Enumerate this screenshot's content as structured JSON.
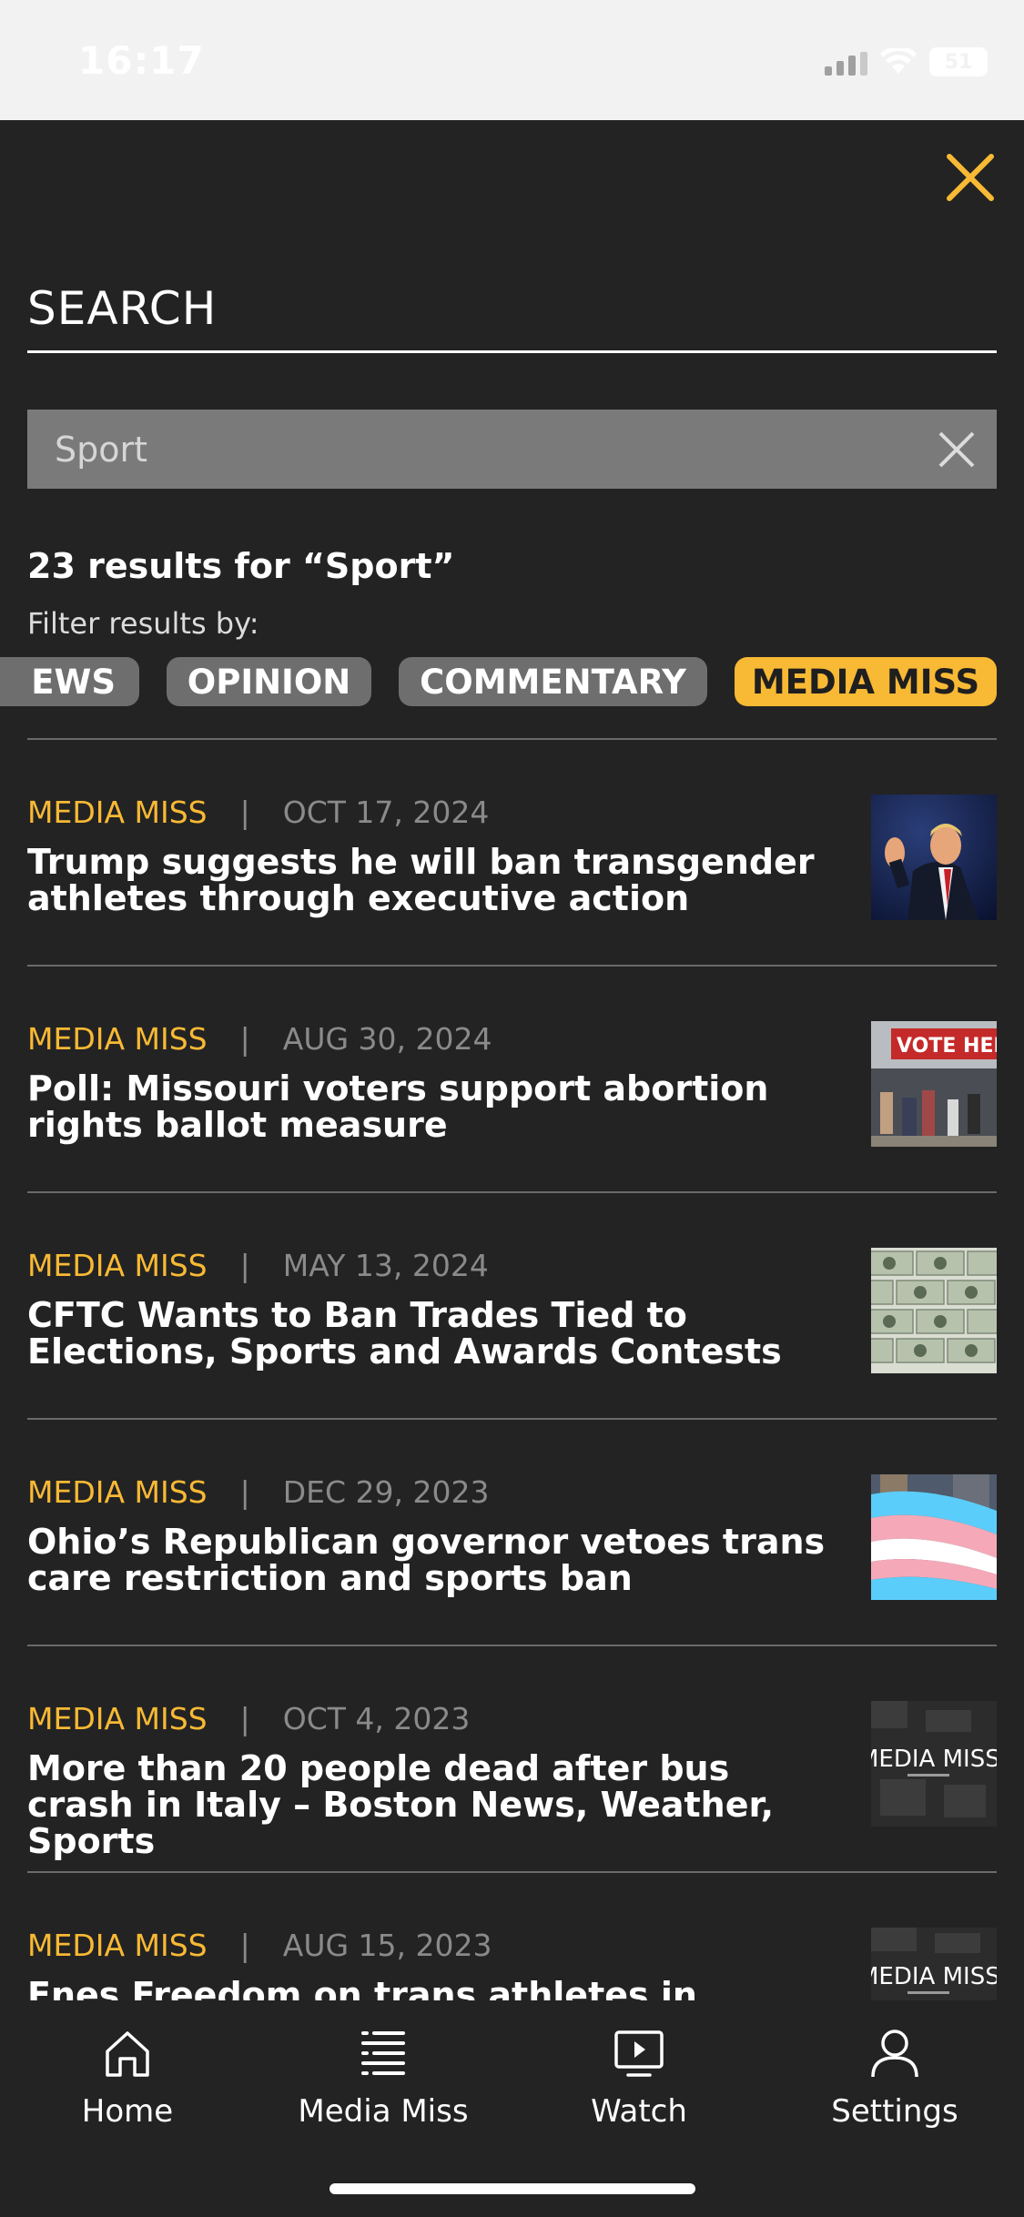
{
  "status_bar": {
    "time": "16:17",
    "battery": "51"
  },
  "search": {
    "title": "SEARCH",
    "value": "Sport",
    "results_count": "23 results for “Sport”",
    "filter_label": "Filter results by:"
  },
  "filters": [
    "EWS",
    "OPINION",
    "COMMENTARY",
    "MEDIA MISS"
  ],
  "active_filter": "MEDIA MISS",
  "articles": [
    {
      "category": "MEDIA MISS",
      "separator": "|",
      "date": "OCT 17, 2024",
      "headline": "Trump suggests he will ban transgender athletes through executive action"
    },
    {
      "category": "MEDIA MISS",
      "separator": "|",
      "date": "AUG 30, 2024",
      "headline": "Poll: Missouri voters support abortion rights ballot measure",
      "thumb_text": "VOTE HERE"
    },
    {
      "category": "MEDIA MISS",
      "separator": "|",
      "date": "MAY 13, 2024",
      "headline": "CFTC Wants to Ban Trades Tied to Elections, Sports and Awards Contests"
    },
    {
      "category": "MEDIA MISS",
      "separator": "|",
      "date": "DEC 29, 2023",
      "headline": "Ohio’s Republican governor vetoes trans care restriction and sports ban"
    },
    {
      "category": "MEDIA MISS",
      "separator": "|",
      "date": "OCT 4, 2023",
      "headline": "More than 20 people dead after bus crash in Italy – Boston News, Weather, Sports",
      "thumb_text": "MEDIA MISS"
    },
    {
      "category": "MEDIA MISS",
      "separator": "|",
      "date": "AUG 15, 2023",
      "headline": "Fnes Freedom on trans athletes in women’s",
      "thumb_text": "MEDIA MISS"
    }
  ],
  "tab_bar": {
    "home": "Home",
    "media_miss": "Media Miss",
    "watch": "Watch",
    "settings": "Settings"
  },
  "colors": {
    "accent": "#f8b934",
    "background": "#232323",
    "chip": "#6e6e6e"
  }
}
